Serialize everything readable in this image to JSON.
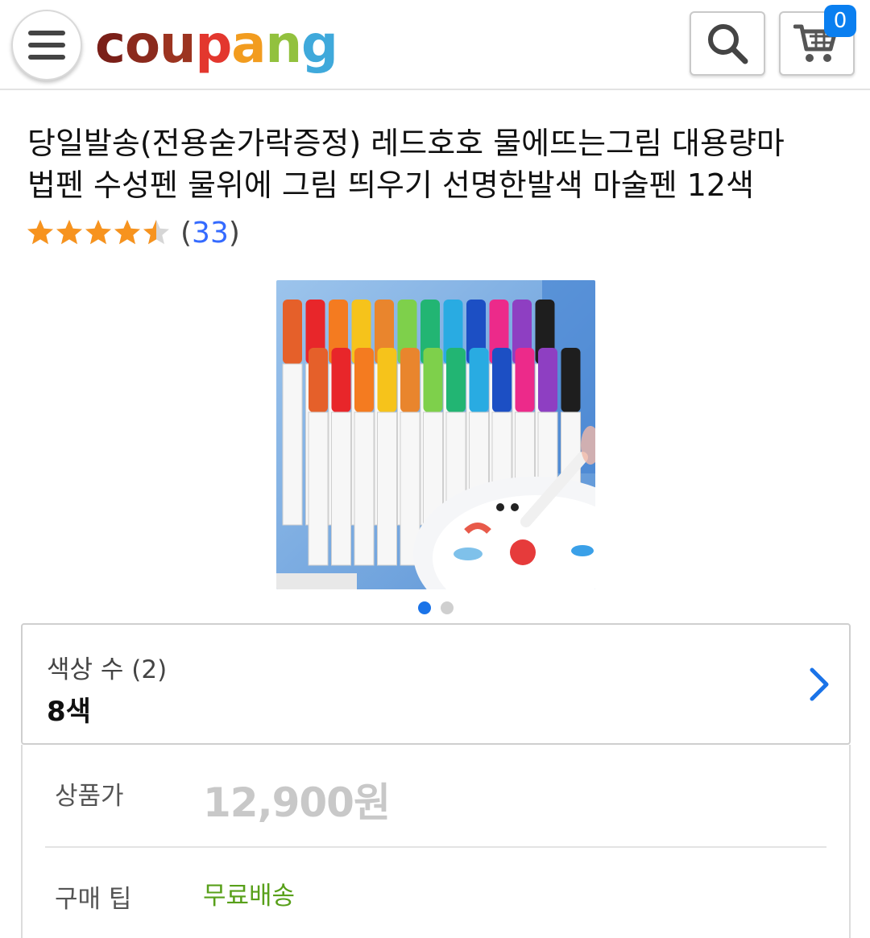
{
  "header": {
    "logo": {
      "text": "coupang",
      "letters": [
        "c",
        "o",
        "u",
        "p",
        "a",
        "n",
        "g"
      ]
    },
    "cart_count": "0"
  },
  "product": {
    "title_line1": "당일발송(전용숟가락증정) 레드호호 물에뜨는그림 대용량마",
    "title_line2": "법펜 수성펜 물위에 그림 띄우기 선명한발색 마술펜 12색",
    "rating": 4.5,
    "review_count": "33",
    "image_count": 2,
    "active_image": 1
  },
  "option": {
    "label": "색상 수 (2)",
    "value": "8색"
  },
  "price": {
    "label": "상품가",
    "value": "12,900원"
  },
  "tip": {
    "label": "구매 팁",
    "value": "무료배송"
  },
  "colors": {
    "badge": "#0a7ff0",
    "star": "#f7931e",
    "link": "#346aff",
    "free_shipping": "#58a01a",
    "dot_active": "#1a73e8",
    "chevron": "#1a73e8"
  },
  "icons": {
    "menu": "hamburger-icon",
    "search": "search-icon",
    "cart": "cart-icon",
    "chevron": "chevron-right-icon",
    "star": "star-icon"
  }
}
